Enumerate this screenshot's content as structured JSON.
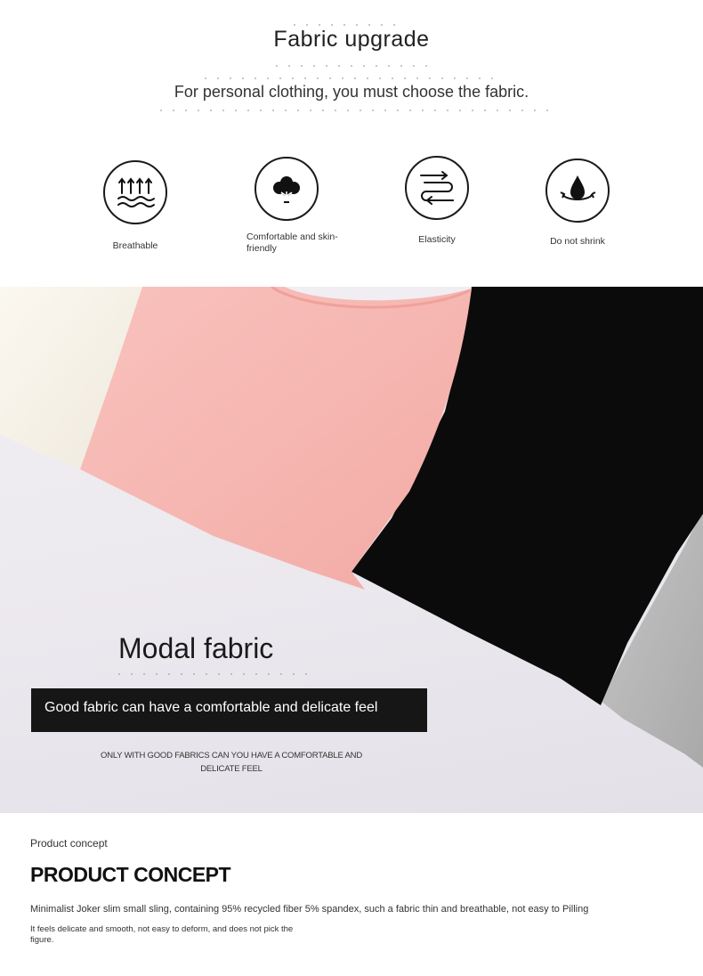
{
  "header": {
    "title": "Fabric upgrade",
    "subtitle": "For personal clothing, you must choose the fabric."
  },
  "features": [
    {
      "label": "Breathable",
      "icon": "breathable-wave-icon"
    },
    {
      "label": "Comfortable and skin-friendly",
      "icon": "cotton-flower-icon"
    },
    {
      "label": "Elasticity",
      "icon": "elastic-arrows-icon"
    },
    {
      "label": "Do not shrink",
      "icon": "water-drop-icon"
    }
  ],
  "banner": {
    "title": "Modal fabric",
    "tagline": "Good fabric can have a comfortable and delicate feel",
    "caption": "ONLY WITH GOOD FABRICS CAN YOU HAVE A COMFORTABLE AND DELICATE FEEL",
    "fabric_colors": [
      "#f7f3ea",
      "#f7b8b3",
      "#0c0c0c",
      "#b9b9b9"
    ]
  },
  "concept": {
    "small_heading": "Product concept",
    "heading": "PRODUCT CONCEPT",
    "line1": "Minimalist Joker slim small sling, containing 95% recycled fiber 5% spandex, such a fabric thin and breathable, not easy to Pilling",
    "line2": "It feels delicate and smooth, not easy to deform, and does not pick the figure."
  }
}
